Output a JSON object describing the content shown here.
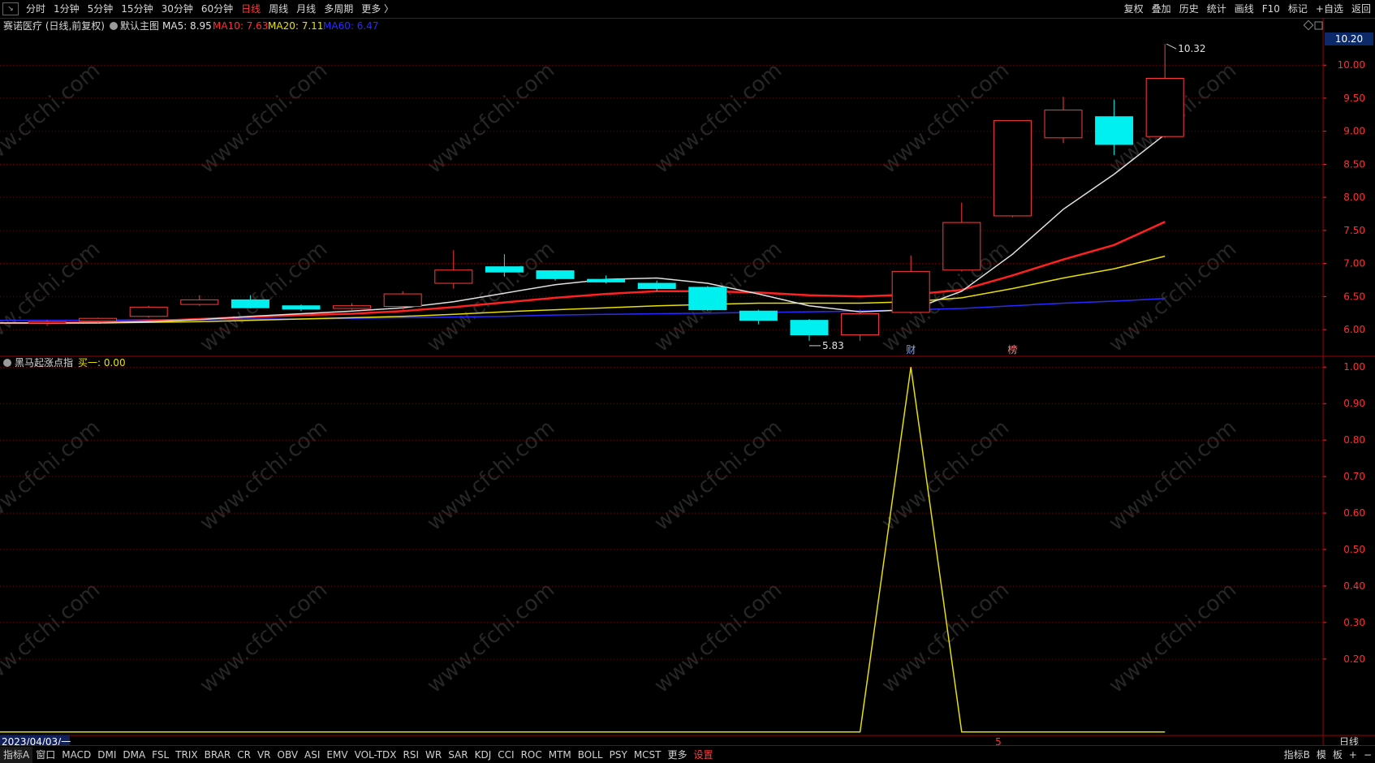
{
  "toolbar": {
    "logo": "↘",
    "periods": [
      "分时",
      "1分钟",
      "5分钟",
      "15分钟",
      "30分钟",
      "60分钟",
      "日线",
      "周线",
      "月线",
      "多周期",
      "更多 〉"
    ],
    "active_period": "日线",
    "right_buttons": [
      "复权",
      "叠加",
      "历史",
      "统计",
      "画线",
      "F10",
      "标记",
      "+自选",
      "返回"
    ]
  },
  "main_panel": {
    "stock_label": "赛诺医疗 (日线,前复权)",
    "indicator_label": "默认主图",
    "ma": [
      {
        "label": "MA5: 8.95",
        "color": "#e0e0e0"
      },
      {
        "label": "MA10: 7.63",
        "color": "#ff3030"
      },
      {
        "label": "MA20: 7.11",
        "color": "#e8e000"
      },
      {
        "label": "MA60: 6.47",
        "color": "#2a2aff"
      }
    ],
    "price_tag": "10.20",
    "high_label": "10.32",
    "low_label": "5.83",
    "markers": [
      {
        "text": "财",
        "color": "#7fa8ff"
      },
      {
        "text": "榜",
        "color": "#ff8080"
      }
    ]
  },
  "sub_panel": {
    "indicator_name": "黑马起涨点指",
    "value_label": "买一: 0.00"
  },
  "date_label": "2023/04/03/一",
  "corner_label": "日线",
  "bottom_marker": "5",
  "bottom_tabs": [
    "指标A",
    "窗口",
    "MACD",
    "DMI",
    "DMA",
    "FSL",
    "TRIX",
    "BRAR",
    "CR",
    "VR",
    "OBV",
    "ASI",
    "EMV",
    "VOL-TDX",
    "RSI",
    "WR",
    "SAR",
    "KDJ",
    "CCI",
    "ROC",
    "MTM",
    "BOLL",
    "PSY",
    "MCST",
    "更多",
    "设置"
  ],
  "bottom_right": [
    "指标B",
    "模",
    "板",
    "+",
    "−"
  ],
  "watermark": "www.cfchi.com",
  "colors": {
    "up": "#ff3b3b",
    "down": "#00f0f0",
    "grid": "#7a0000",
    "axis_text": "#ff3030",
    "ma5": "#e0e0e0",
    "ma10": "#ff2020",
    "ma20": "#e8e000",
    "ma60": "#2a2aff",
    "sub_line": "#e8e000"
  },
  "chart_data": [
    {
      "type": "candlestick",
      "title": "赛诺医疗 (日线,前复权)",
      "y_ticks": [
        6.0,
        6.5,
        7.0,
        7.5,
        8.0,
        8.5,
        9.0,
        9.5,
        10.0
      ],
      "ylim": [
        5.62,
        10.42
      ],
      "candles": [
        {
          "o": 6.1,
          "h": 6.14,
          "l": 6.06,
          "c": 6.12
        },
        {
          "o": 6.13,
          "h": 6.18,
          "l": 6.1,
          "c": 6.17
        },
        {
          "o": 6.2,
          "h": 6.36,
          "l": 6.18,
          "c": 6.34
        },
        {
          "o": 6.38,
          "h": 6.52,
          "l": 6.36,
          "c": 6.45
        },
        {
          "o": 6.45,
          "h": 6.52,
          "l": 6.32,
          "c": 6.33
        },
        {
          "o": 6.36,
          "h": 6.38,
          "l": 6.28,
          "c": 6.31
        },
        {
          "o": 6.32,
          "h": 6.4,
          "l": 6.3,
          "c": 6.36
        },
        {
          "o": 6.35,
          "h": 6.58,
          "l": 6.3,
          "c": 6.54
        },
        {
          "o": 6.7,
          "h": 7.2,
          "l": 6.62,
          "c": 6.9
        },
        {
          "o": 6.95,
          "h": 7.14,
          "l": 6.8,
          "c": 6.87
        },
        {
          "o": 6.89,
          "h": 6.9,
          "l": 6.74,
          "c": 6.77
        },
        {
          "o": 6.76,
          "h": 6.82,
          "l": 6.7,
          "c": 6.72
        },
        {
          "o": 6.7,
          "h": 6.74,
          "l": 6.58,
          "c": 6.62
        },
        {
          "o": 6.64,
          "h": 6.66,
          "l": 6.28,
          "c": 6.3
        },
        {
          "o": 6.28,
          "h": 6.3,
          "l": 6.08,
          "c": 6.14
        },
        {
          "o": 6.14,
          "h": 6.16,
          "l": 5.83,
          "c": 5.92
        },
        {
          "o": 5.92,
          "h": 6.3,
          "l": 5.83,
          "c": 6.24
        },
        {
          "o": 6.26,
          "h": 7.12,
          "l": 6.24,
          "c": 6.88
        },
        {
          "o": 6.9,
          "h": 7.92,
          "l": 6.88,
          "c": 7.62
        },
        {
          "o": 7.72,
          "h": 9.16,
          "l": 7.7,
          "c": 9.16
        },
        {
          "o": 8.9,
          "h": 9.52,
          "l": 8.82,
          "c": 9.32
        },
        {
          "o": 9.22,
          "h": 9.48,
          "l": 8.64,
          "c": 8.8
        },
        {
          "o": 8.92,
          "h": 10.32,
          "l": 8.9,
          "c": 9.8
        }
      ],
      "ma5": [
        6.1,
        6.1,
        6.12,
        6.15,
        6.2,
        6.24,
        6.28,
        6.33,
        6.42,
        6.55,
        6.68,
        6.76,
        6.78,
        6.7,
        6.54,
        6.36,
        6.27,
        6.3,
        6.58,
        7.14,
        7.82,
        8.35,
        8.95
      ],
      "ma10": [
        6.1,
        6.11,
        6.13,
        6.16,
        6.19,
        6.22,
        6.24,
        6.28,
        6.34,
        6.41,
        6.48,
        6.54,
        6.58,
        6.58,
        6.56,
        6.52,
        6.5,
        6.53,
        6.6,
        6.82,
        7.06,
        7.28,
        7.63
      ],
      "ma20": [
        6.1,
        6.1,
        6.11,
        6.12,
        6.14,
        6.16,
        6.18,
        6.2,
        6.23,
        6.27,
        6.3,
        6.33,
        6.36,
        6.38,
        6.4,
        6.4,
        6.4,
        6.42,
        6.48,
        6.62,
        6.78,
        6.92,
        7.11
      ],
      "ma60": [
        6.14,
        6.14,
        6.15,
        6.15,
        6.16,
        6.16,
        6.17,
        6.18,
        6.19,
        6.2,
        6.22,
        6.23,
        6.24,
        6.25,
        6.26,
        6.27,
        6.28,
        6.3,
        6.32,
        6.36,
        6.4,
        6.43,
        6.47
      ]
    },
    {
      "type": "line",
      "title": "黑马起涨点指",
      "y_ticks": [
        0.2,
        0.3,
        0.4,
        0.5,
        0.6,
        0.7,
        0.8,
        0.9,
        1.0
      ],
      "ylim": [
        -0.005,
        1.005
      ],
      "series": [
        {
          "name": "买一",
          "values": [
            0,
            0,
            0,
            0,
            0,
            0,
            0,
            0,
            0,
            0,
            0,
            0,
            0,
            0,
            0,
            0,
            0,
            1,
            0,
            0,
            0,
            0,
            0
          ]
        }
      ]
    }
  ]
}
